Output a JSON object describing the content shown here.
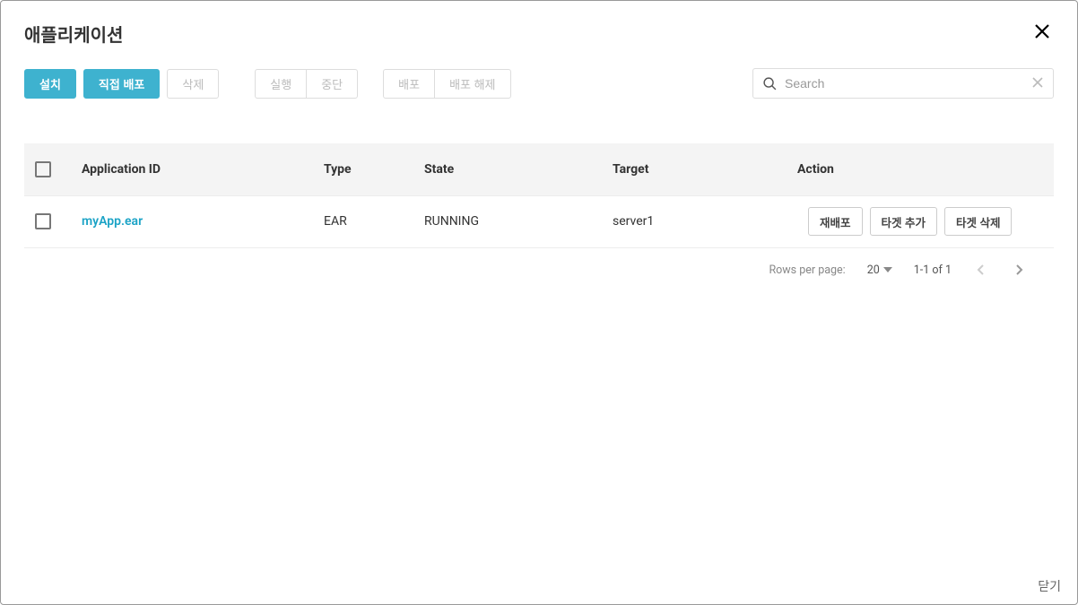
{
  "modal": {
    "title": "애플리케이션",
    "close_label": "닫기"
  },
  "toolbar": {
    "install": "설치",
    "direct_deploy": "직접 배포",
    "delete": "삭제",
    "run": "실행",
    "stop": "중단",
    "deploy": "배포",
    "undeploy": "배포 해제"
  },
  "search": {
    "placeholder": "Search"
  },
  "table": {
    "headers": {
      "app_id": "Application ID",
      "type": "Type",
      "state": "State",
      "target": "Target",
      "action": "Action"
    },
    "rows": [
      {
        "app_id": "myApp.ear",
        "type": "EAR",
        "state": "RUNNING",
        "target": "server1",
        "actions": {
          "redeploy": "재배포",
          "add_target": "타겟 추가",
          "remove_target": "타겟 삭제"
        }
      }
    ]
  },
  "pager": {
    "rows_per_page_label": "Rows per page:",
    "rows_per_page_value": "20",
    "range": "1-1 of 1"
  }
}
